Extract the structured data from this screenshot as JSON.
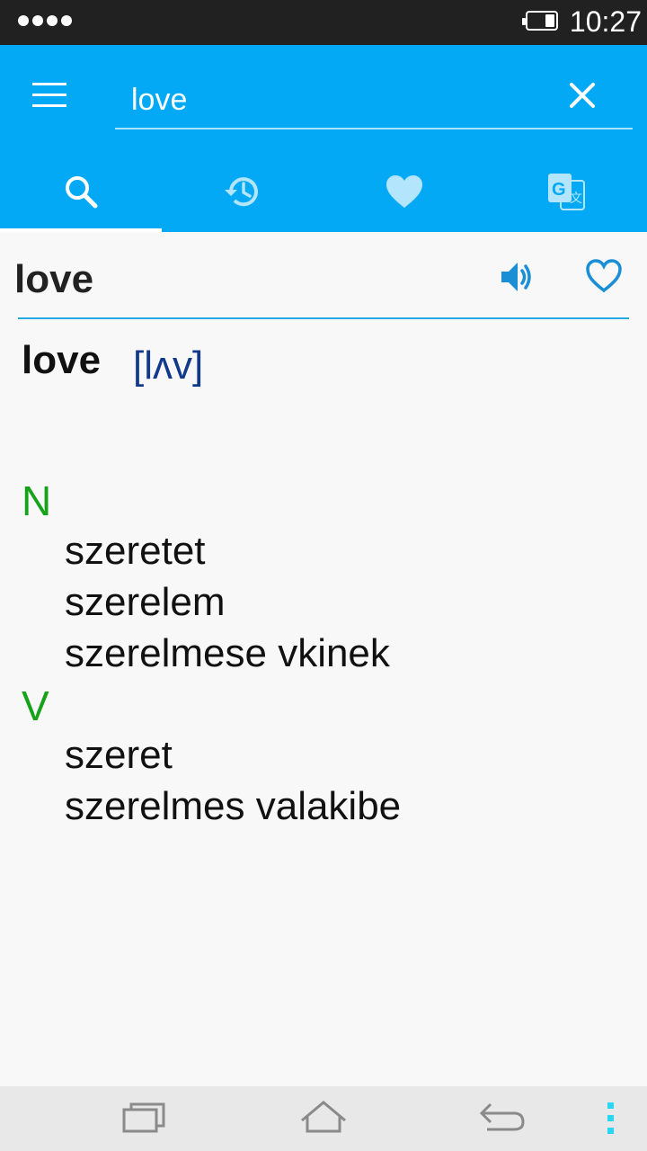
{
  "status_bar": {
    "time": "10:27",
    "signal_icon": "signal-dots-icon",
    "battery_icon": "battery-icon",
    "battery_level": 0.25
  },
  "search": {
    "query": "love",
    "menu_icon": "menu-icon",
    "clear_icon": "close-icon"
  },
  "tabs": [
    {
      "icon": "search-icon",
      "active": true
    },
    {
      "icon": "history-icon",
      "active": false
    },
    {
      "icon": "favorites-heart-icon",
      "active": false
    },
    {
      "icon": "translate-icon",
      "active": false
    }
  ],
  "entry": {
    "word": "love",
    "headword": "love",
    "pronunciation": "[lʌv]",
    "speaker_icon": "speaker-icon",
    "favorite_icon": "heart-outline-icon",
    "parts_of_speech": [
      {
        "pos": "N",
        "senses": [
          "szeretet",
          "szerelem",
          "szerelmese vkinek"
        ]
      },
      {
        "pos": "V",
        "senses": [
          "szeret",
          "szerelmes valakibe"
        ]
      }
    ]
  },
  "colors": {
    "app_bar": "#03a9f4",
    "accent": "#29a8e0",
    "pos_green": "#16a31a",
    "pronunciation_blue": "#123a8c"
  },
  "nav_bar": {
    "recents_icon": "recents-icon",
    "home_icon": "home-icon",
    "back_icon": "back-icon",
    "more_icon": "more-icon"
  }
}
